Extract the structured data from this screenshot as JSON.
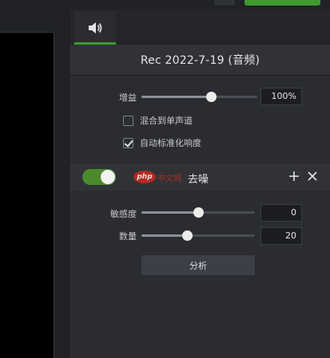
{
  "panel": {
    "tab_audio_icon": "speaker-icon",
    "title": "Rec 2022-7-19 (音频)"
  },
  "gain": {
    "label": "增益",
    "value_text": "100%",
    "slider_fraction": 0.6
  },
  "checkboxes": {
    "mix_to_mono": {
      "label": "混合到单声道",
      "checked": false
    },
    "auto_normalize": {
      "label": "自动标准化响度",
      "checked": true
    }
  },
  "denoise": {
    "enabled": true,
    "title": "去噪",
    "add_icon": "plus-icon",
    "close_icon": "close-icon",
    "sensitivity": {
      "label": "敏感度",
      "value_text": "0",
      "slider_fraction": 0.5
    },
    "amount": {
      "label": "数量",
      "value_text": "20",
      "slider_fraction": 0.4
    },
    "analyze_label": "分析"
  },
  "watermark": {
    "logo_text": "php",
    "text": "中文网"
  },
  "colors": {
    "accent_green": "#3f9a2f",
    "panel_bg": "#2a2c31",
    "header_bg": "#303237"
  }
}
